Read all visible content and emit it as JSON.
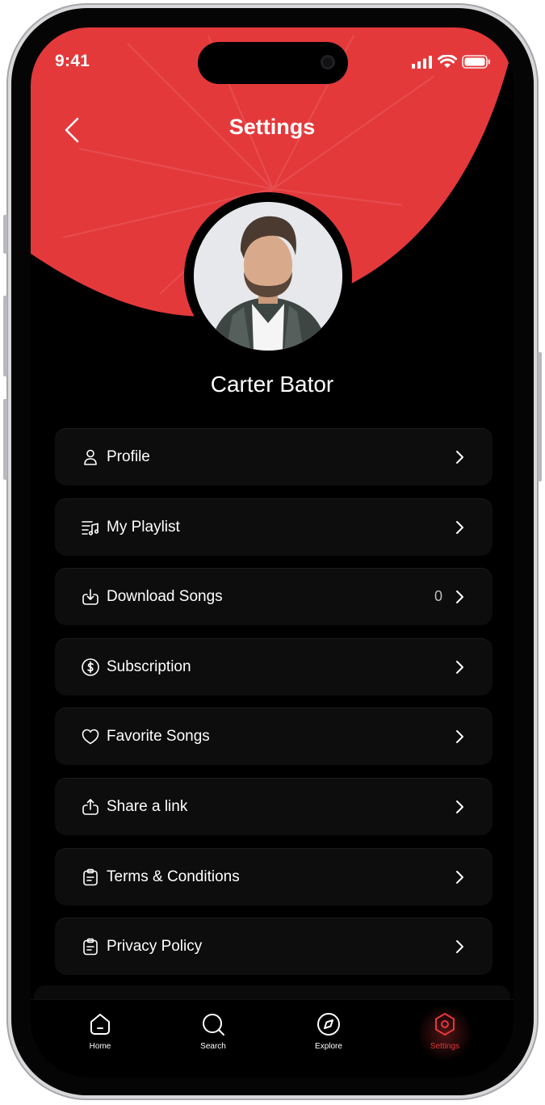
{
  "status_bar": {
    "time": "9:41"
  },
  "header": {
    "title": "Settings",
    "back_icon": "chevron-left-icon"
  },
  "profile": {
    "name": "Carter Bator"
  },
  "menu": [
    {
      "label": "Profile",
      "icon": "user-icon"
    },
    {
      "label": "My Playlist",
      "icon": "playlist-icon"
    },
    {
      "label": "Download Songs",
      "icon": "download-icon",
      "count": "0"
    },
    {
      "label": "Subscription",
      "icon": "dollar-circle-icon"
    },
    {
      "label": "Favorite Songs",
      "icon": "heart-icon"
    },
    {
      "label": "Share a link",
      "icon": "share-icon"
    },
    {
      "label": "Terms & Conditions",
      "icon": "clipboard-icon"
    },
    {
      "label": "Privacy Policy",
      "icon": "clipboard-icon"
    }
  ],
  "tabbar": {
    "items": [
      {
        "label": "Home",
        "icon": "home-icon"
      },
      {
        "label": "Search",
        "icon": "search-icon"
      },
      {
        "label": "Explore",
        "icon": "compass-icon"
      },
      {
        "label": "Settings",
        "icon": "settings-hexagon-icon",
        "active": true
      }
    ]
  },
  "colors": {
    "accent": "#E4393B",
    "background": "#000000",
    "card": "#0D0D0D"
  }
}
